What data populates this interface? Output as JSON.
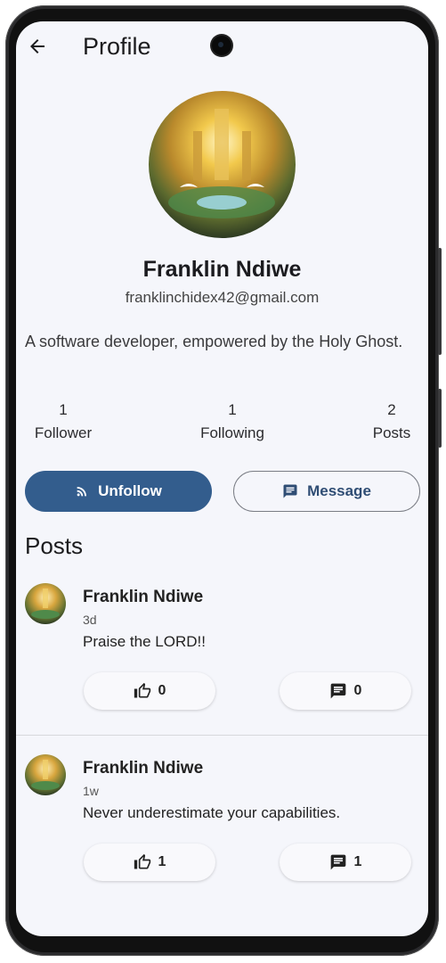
{
  "header": {
    "title": "Profile"
  },
  "profile": {
    "name": "Franklin Ndiwe",
    "email": "franklinchidex42@gmail.com",
    "bio": "A software developer, empowered by the Holy Ghost."
  },
  "stats": [
    {
      "num": "1",
      "label": "Follower"
    },
    {
      "num": "1",
      "label": "Following"
    },
    {
      "num": "2",
      "label": "Posts"
    }
  ],
  "actions": {
    "unfollow_label": "Unfollow",
    "message_label": "Message"
  },
  "posts_section": {
    "title": "Posts"
  },
  "posts": [
    {
      "author": "Franklin Ndiwe",
      "time": "3d",
      "text": "Praise the LORD!!",
      "likes": "0",
      "comments": "0"
    },
    {
      "author": "Franklin Ndiwe",
      "time": "1w",
      "text": "Never underestimate your capabilities.",
      "likes": "1",
      "comments": "1"
    }
  ],
  "colors": {
    "accent": "#335d8d",
    "background": "#f5f6fb"
  },
  "icons": [
    "arrow-back-icon",
    "rss-feed-icon",
    "message-icon",
    "thumb-up-icon",
    "comment-icon"
  ]
}
